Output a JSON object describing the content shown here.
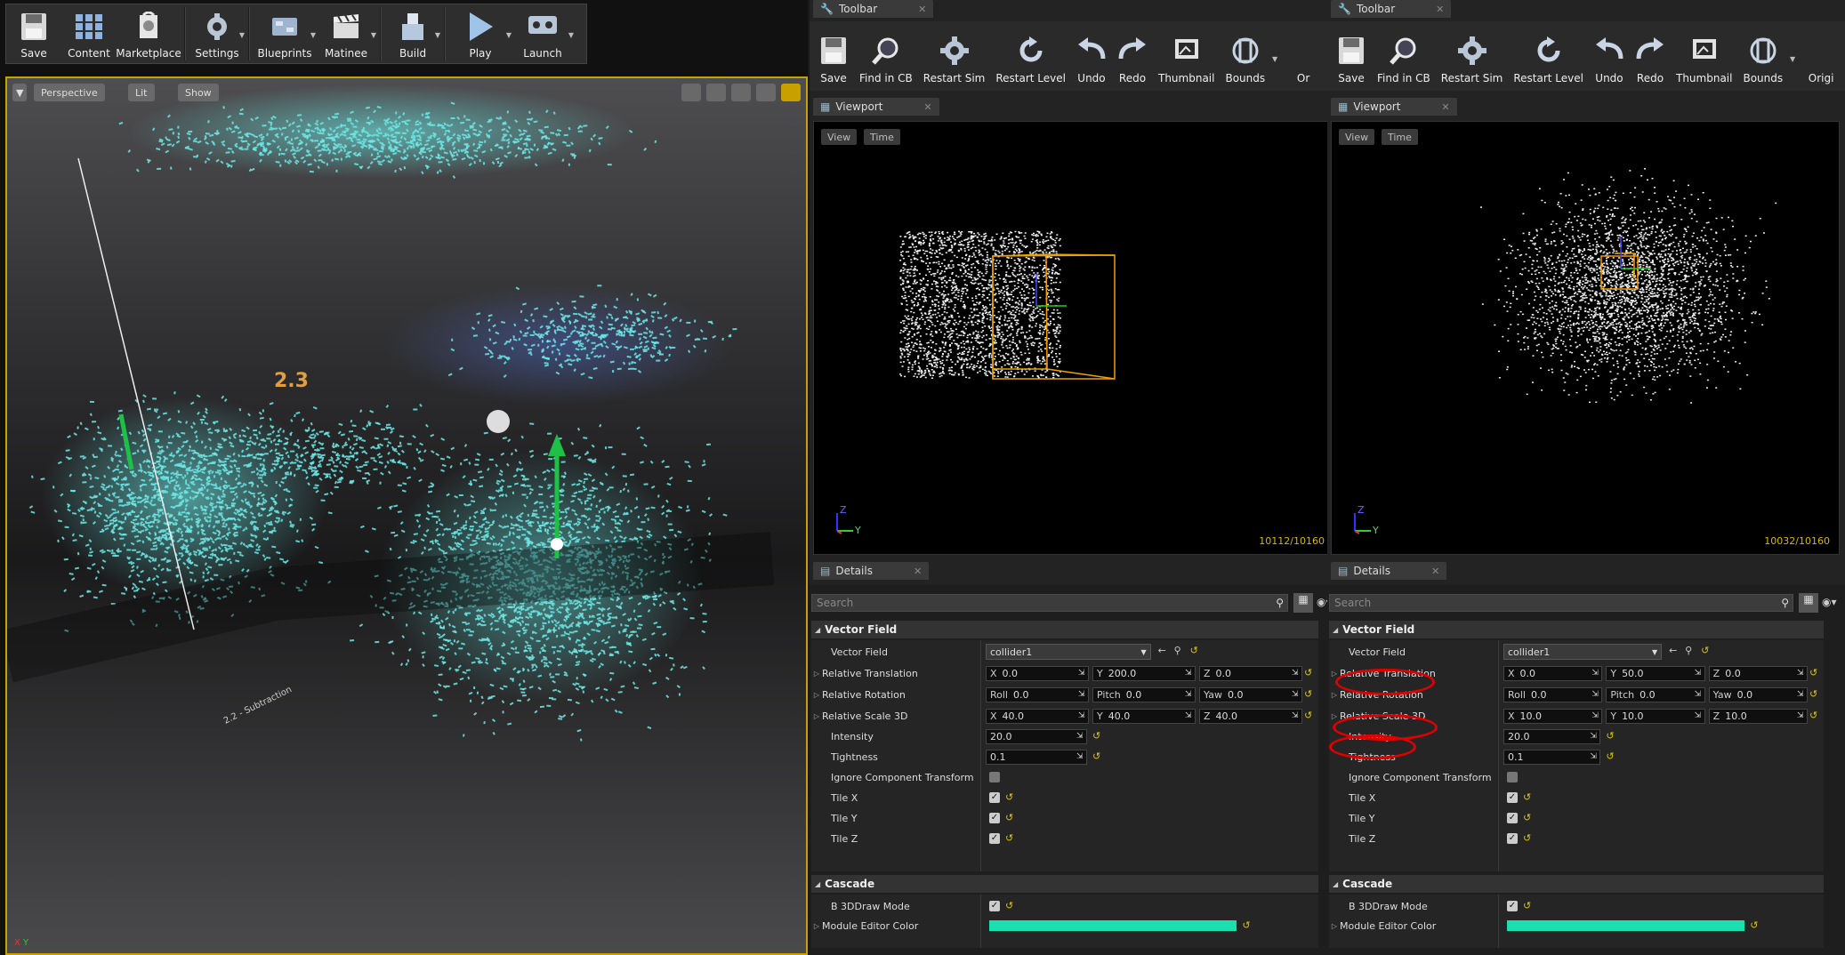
{
  "main_toolbar": [
    {
      "label": "Save",
      "icon": "save-icon"
    },
    {
      "label": "Content",
      "icon": "content-browser-icon"
    },
    {
      "label": "Marketplace",
      "icon": "marketplace-icon"
    },
    {
      "label": "Settings",
      "icon": "settings-icon"
    },
    {
      "label": "Blueprints",
      "icon": "blueprints-icon"
    },
    {
      "label": "Matinee",
      "icon": "matinee-icon"
    },
    {
      "label": "Build",
      "icon": "build-icon"
    },
    {
      "label": "Play",
      "icon": "play-icon"
    },
    {
      "label": "Launch",
      "icon": "launch-icon"
    }
  ],
  "main_viewport": {
    "perspective": "Perspective",
    "lit": "Lit",
    "show": "Show",
    "axis_x": "X",
    "axis_y": "Y",
    "floor_sign": "2.2 - Subtraction",
    "label_23": "2.3"
  },
  "panes": [
    {
      "toolbar_tab": "Toolbar",
      "toolbar": [
        "Save",
        "Find in CB",
        "Restart Sim",
        "Restart Level",
        "Undo",
        "Redo",
        "Thumbnail",
        "Bounds",
        "Or"
      ],
      "viewport_tab": "Viewport",
      "view_btn": "View",
      "time_btn": "Time",
      "particle_count": "10112/10160",
      "axis_z": "Z",
      "axis_y": "Y",
      "details_tab": "Details",
      "search_placeholder": "Search",
      "vector_field_section": "Vector Field",
      "vector_field_label": "Vector Field",
      "vector_field_value": "collider1",
      "relative_translation": {
        "label": "Relative Translation",
        "x": "0.0",
        "y": "200.0",
        "z": "0.0"
      },
      "relative_rotation": {
        "label": "Relative Rotation",
        "roll": "0.0",
        "pitch": "0.0",
        "yaw": "0.0"
      },
      "relative_scale": {
        "label": "Relative Scale 3D",
        "x": "40.0",
        "y": "40.0",
        "z": "40.0"
      },
      "intensity": {
        "label": "Intensity",
        "value": "20.0"
      },
      "tightness": {
        "label": "Tightness",
        "value": "0.1"
      },
      "ignore_component_transform": "Ignore Component Transform",
      "tile_x": "Tile X",
      "tile_y": "Tile Y",
      "tile_z": "Tile Z",
      "cascade_section": "Cascade",
      "b3d_draw_mode": "B 3DDraw Mode",
      "module_editor_color": "Module Editor Color",
      "module_color": "#19e0b0"
    },
    {
      "toolbar_tab": "Toolbar",
      "toolbar": [
        "Save",
        "Find in CB",
        "Restart Sim",
        "Restart Level",
        "Undo",
        "Redo",
        "Thumbnail",
        "Bounds",
        "Origi"
      ],
      "viewport_tab": "Viewport",
      "view_btn": "View",
      "time_btn": "Time",
      "particle_count": "10032/10160",
      "axis_z": "Z",
      "axis_y": "Y",
      "details_tab": "Details",
      "search_placeholder": "Search",
      "vector_field_section": "Vector Field",
      "vector_field_label": "Vector Field",
      "vector_field_value": "collider1",
      "relative_translation": {
        "label": "Relative Translation",
        "x": "0.0",
        "y": "50.0",
        "z": "0.0"
      },
      "relative_rotation": {
        "label": "Relative Rotation",
        "roll": "0.0",
        "pitch": "0.0",
        "yaw": "0.0"
      },
      "relative_scale": {
        "label": "Relative Scale 3D",
        "x": "10.0",
        "y": "10.0",
        "z": "10.0"
      },
      "intensity": {
        "label": "Intensity",
        "value": "20.0"
      },
      "tightness": {
        "label": "Tightness",
        "value": "0.1"
      },
      "ignore_component_transform": "Ignore Component Transform",
      "tile_x": "Tile X",
      "tile_y": "Tile Y",
      "tile_z": "Tile Z",
      "cascade_section": "Cascade",
      "b3d_draw_mode": "B 3DDraw Mode",
      "module_editor_color": "Module Editor Color",
      "module_color": "#19e0b0"
    }
  ],
  "axis_labels": {
    "x": "X",
    "y": "Y",
    "roll": "Roll",
    "pitch": "Pitch",
    "yaw": "Yaw",
    "z": "Z"
  },
  "colors": {
    "particle_cyan": "#6ee8e6",
    "selection_orange": "#f0a000",
    "annotation_red": "#e00000"
  }
}
